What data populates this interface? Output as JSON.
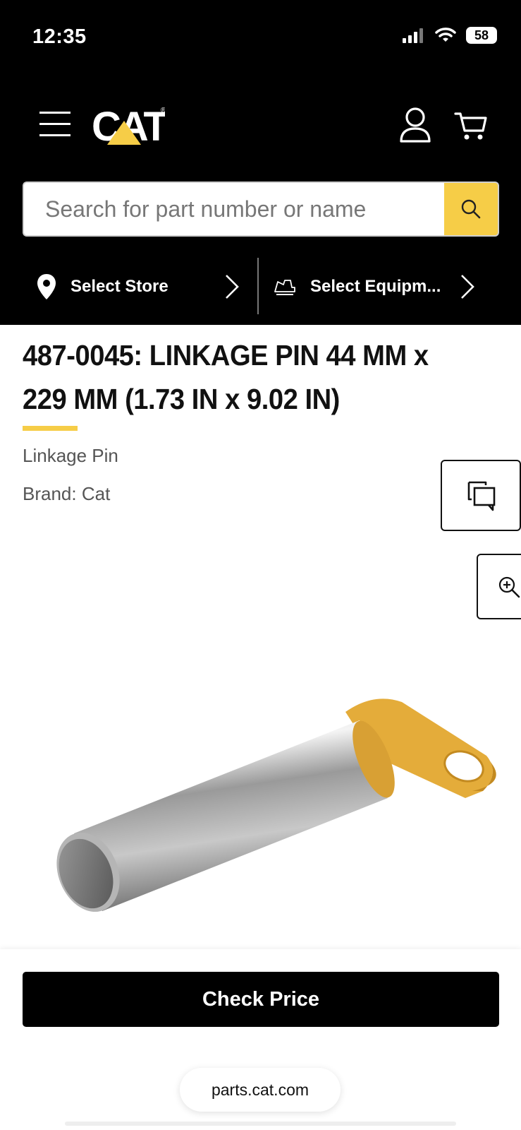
{
  "status_bar": {
    "time": "12:35",
    "battery": "58"
  },
  "search": {
    "placeholder": "Search for part number or name"
  },
  "selectors": {
    "store_label": "Select Store",
    "equipment_label": "Select Equipm..."
  },
  "product": {
    "title": "487-0045: LINKAGE PIN 44 MM x 229 MM (1.73 IN x 9.02 IN)",
    "subtitle": "Linkage Pin",
    "brand": "Brand: Cat"
  },
  "footer": {
    "check_price_label": "Check Price",
    "url": "parts.cat.com"
  },
  "colors": {
    "accent": "#f6cd47",
    "header_bg": "#000000",
    "button_bg": "#000000"
  },
  "icons": [
    "menu-icon",
    "cat-logo",
    "user-icon",
    "cart-icon",
    "search-icon",
    "location-pin-icon",
    "chevron-right-icon",
    "excavator-icon",
    "compare-icon",
    "zoom-in-icon"
  ]
}
